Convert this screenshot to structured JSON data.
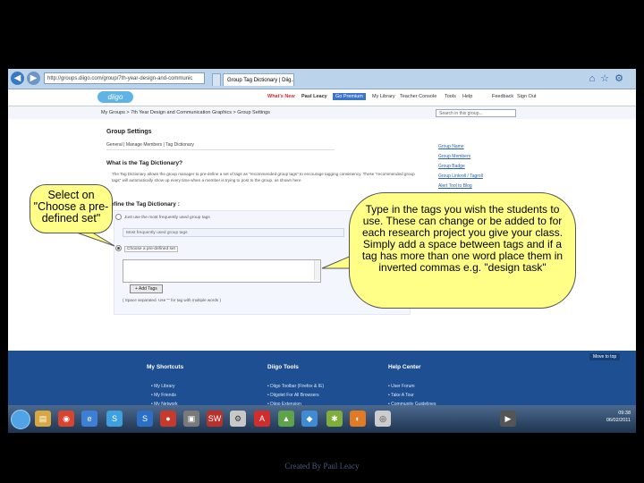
{
  "browser": {
    "address": "http://groups.diigo.com/group/7th-year-design-and-communic",
    "active_tab": "Group Tag Dictionary | Diig...",
    "inactive_tab": "",
    "back_icon": "back-arrow-icon",
    "forward_icon": "forward-arrow-icon"
  },
  "diigo_bar": {
    "logo": "diigo",
    "whats_new": "What's New",
    "user": "Paul Leacy",
    "premium": "Go Premium",
    "nav": [
      "My Library",
      "Teacher Console",
      "Tools",
      "Help",
      "Feedback",
      "Sign Out"
    ]
  },
  "breadcrumb": {
    "path": "My Groups  >  7th Year Design and Communication Graphics  >  Group Settings",
    "search_placeholder": "Search in this group..."
  },
  "main": {
    "title": "Group Settings",
    "subnav": "General  |  Manage Members  |  Tag Dictionary",
    "what_heading": "What is the Tag Dictionary?",
    "what_text": "The Tag Dictionary allows the group manager to pre-define a set of tags as \"recommended group tags\" to encourage tagging consistency. These \"recommended group tags\" will automatically show up every time when a member is trying to post to the group, as shown here",
    "define_heading": "Define the Tag Dictionary :",
    "option_frequent": "Just use the most frequently used group tags",
    "frequent_box": "Most frequently used group tags",
    "option_predefined": "Choose a pre-defined set",
    "add_tags_button": "+ Add Tags",
    "hint": "( Space separated. Use \"\" for tag with multiple words )"
  },
  "sidebar": {
    "items": [
      "Group Name",
      "Group Members",
      "Group Badge",
      "Group Linkroll / Tagroll",
      "Alert Tool to Blog"
    ]
  },
  "footer": {
    "move_to_top": "Move to top",
    "shortcuts_heading": "My Shortcuts",
    "shortcuts": [
      "My Library",
      "My Friends",
      "My Network"
    ],
    "tools_heading": "Diigo Tools",
    "tools": [
      "Diigo Toolbar (Firefox & IE)",
      "Diigolet For All Browsers",
      "Diigo Extension"
    ],
    "help_heading": "Help Center",
    "help": [
      "User Forum",
      "Take A Tour",
      "Community Guidelines"
    ]
  },
  "taskbar": {
    "time": "09:38",
    "date": "06/02/2011"
  },
  "callouts": {
    "left": "Select on \"Choose a pre-defined set\"",
    "right": "Type in the tags you wish the students to use. These can change or be added to for each research project you give your class. Simply add a space between tags and if a tag has more than one word place them in inverted commas e.g. \"design task\""
  },
  "credit": "Created By Paul Leacy",
  "colors": {
    "callout_fill": "#ffff88",
    "footer_blue": "#1d4f92",
    "whats_new_red": "#d12b2b"
  }
}
